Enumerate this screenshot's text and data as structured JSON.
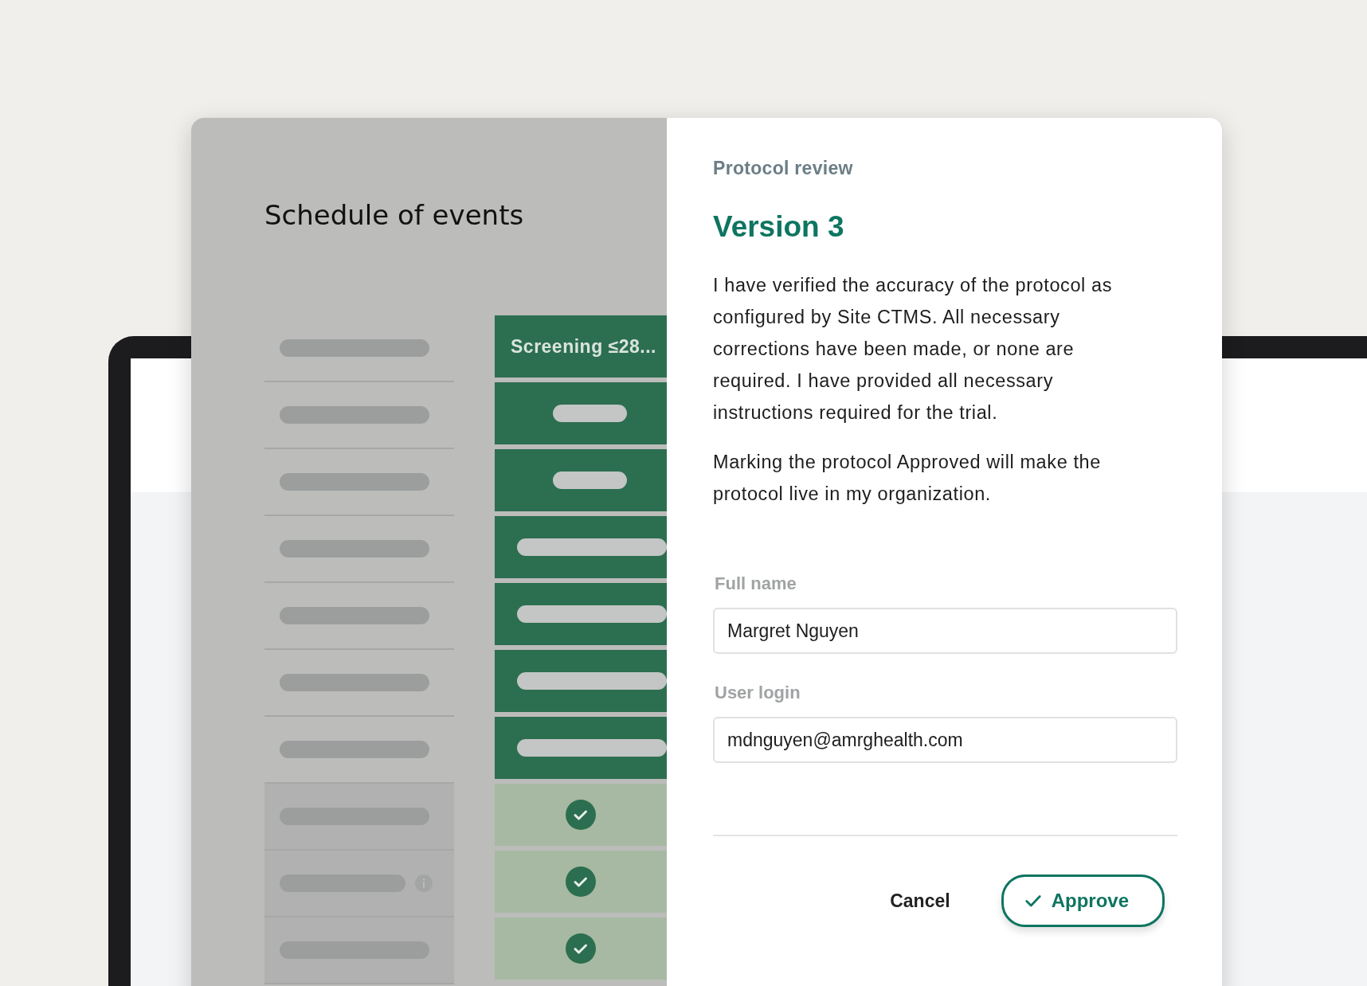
{
  "schedule": {
    "title": "Schedule of events",
    "column_header": "Screening ≤28...",
    "rows": [
      {
        "kind": "short",
        "info": false
      },
      {
        "kind": "short",
        "info": false
      },
      {
        "kind": "long",
        "info": false
      },
      {
        "kind": "long",
        "info": false
      },
      {
        "kind": "long",
        "info": false
      },
      {
        "kind": "long",
        "info": false
      },
      {
        "kind": "check",
        "info": false
      },
      {
        "kind": "check",
        "info": true
      },
      {
        "kind": "check",
        "info": false
      }
    ]
  },
  "dialog": {
    "eyebrow": "Protocol review",
    "title": "Version 3",
    "paragraphs": [
      "I have verified the accuracy of the protocol as configured by Site CTMS. All necessary corrections have been made, or none are required. I have provided all necessary instructions required for the trial.",
      "Marking the protocol Approved will make the protocol live in my organization."
    ],
    "fields": [
      {
        "label": "Full name",
        "value": "Margret Nguyen"
      },
      {
        "label": "User login",
        "value": "mdnguyen@amrghealth.com"
      }
    ],
    "buttons": [
      {
        "label": "Cancel",
        "kind": "text"
      },
      {
        "label": "Approve",
        "kind": "outline"
      }
    ]
  }
}
